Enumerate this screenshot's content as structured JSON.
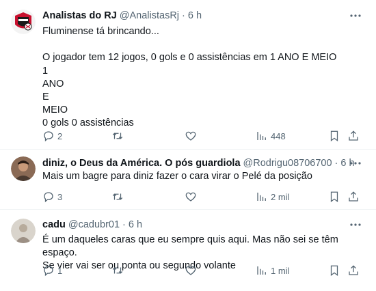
{
  "tweets": [
    {
      "name": "Analistas do RJ",
      "handle": "@AnalistasRj",
      "separator": "·",
      "time": "6 h",
      "text": "Fluminense tá brincando...\n\nO jogador tem 12 jogos, 0 gols e 0 assistências em 1 ANO E MEIO\n1\nANO\nE\nMEIO\n0 gols 0 assistências",
      "replies": "2",
      "retweets": "",
      "likes": "",
      "views": "448"
    },
    {
      "name": "diniz, o Deus da América. O pós guardiola",
      "handle": "@Rodrigu08706700",
      "separator": "·",
      "time": "6 h",
      "text": "Mais um bagre para diniz fazer o cara virar o Pelé da posição",
      "replies": "3",
      "retweets": "",
      "likes": "",
      "views": "2 mil"
    },
    {
      "name": "cadu",
      "handle": "@cadubr01",
      "separator": "·",
      "time": "6 h",
      "text": "É um daqueles  caras que eu sempre quis aqui. Mas não sei se têm espaço.\nSe vier vai ser ou ponta ou segundo volante",
      "replies": "1",
      "retweets": "",
      "likes": "",
      "views": "1 mil"
    }
  ],
  "icons": {
    "more": "more-dots-icon",
    "reply": "reply-bubble-icon",
    "retweet": "retweet-arrows-icon",
    "like": "heart-icon",
    "views": "views-bar-chart-icon",
    "bookmark": "bookmark-icon",
    "share": "share-upload-icon"
  },
  "colors": {
    "text": "#0f1419",
    "secondary": "#536471",
    "divider": "#eff3f4"
  }
}
